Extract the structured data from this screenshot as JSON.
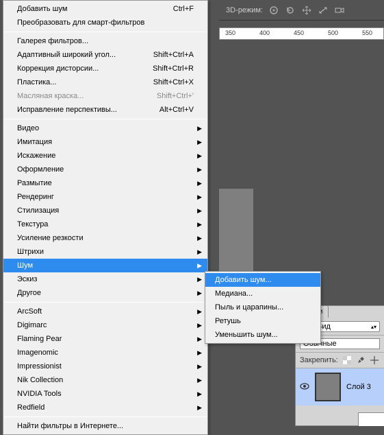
{
  "toolbar3d": {
    "label": "3D-режим:"
  },
  "ruler": {
    "ticks": [
      "350",
      "400",
      "450",
      "500",
      "550"
    ]
  },
  "panels": {
    "layersTab": "Слои",
    "viewLabel": "Вид",
    "blendMode": "Обычные",
    "lockLabel": "Закрепить:",
    "layerName": "Слой 3"
  },
  "menu": [
    {
      "type": "item",
      "label": "Добавить шум",
      "shortcut": "Ctrl+F"
    },
    {
      "type": "item",
      "label": "Преобразовать для смарт-фильтров"
    },
    {
      "type": "sep"
    },
    {
      "type": "item",
      "label": "Галерея фильтров..."
    },
    {
      "type": "item",
      "label": "Адаптивный широкий угол...",
      "shortcut": "Shift+Ctrl+A"
    },
    {
      "type": "item",
      "label": "Коррекция дисторсии...",
      "shortcut": "Shift+Ctrl+R"
    },
    {
      "type": "item",
      "label": "Пластика...",
      "shortcut": "Shift+Ctrl+X"
    },
    {
      "type": "item",
      "label": "Масляная краска...",
      "shortcut": "Shift+Ctrl+'",
      "disabled": true
    },
    {
      "type": "item",
      "label": "Исправление перспективы...",
      "shortcut": "Alt+Ctrl+V"
    },
    {
      "type": "sep"
    },
    {
      "type": "item",
      "label": "Видео",
      "submenu": true
    },
    {
      "type": "item",
      "label": "Имитация",
      "submenu": true
    },
    {
      "type": "item",
      "label": "Искажение",
      "submenu": true
    },
    {
      "type": "item",
      "label": "Оформление",
      "submenu": true
    },
    {
      "type": "item",
      "label": "Размытие",
      "submenu": true
    },
    {
      "type": "item",
      "label": "Рендеринг",
      "submenu": true
    },
    {
      "type": "item",
      "label": "Стилизация",
      "submenu": true
    },
    {
      "type": "item",
      "label": "Текстура",
      "submenu": true
    },
    {
      "type": "item",
      "label": "Усиление резкости",
      "submenu": true
    },
    {
      "type": "item",
      "label": "Штрихи",
      "submenu": true
    },
    {
      "type": "item",
      "label": "Шум",
      "submenu": true,
      "highlight": true
    },
    {
      "type": "item",
      "label": "Эскиз",
      "submenu": true
    },
    {
      "type": "item",
      "label": "Другое",
      "submenu": true
    },
    {
      "type": "sep"
    },
    {
      "type": "item",
      "label": "ArcSoft",
      "submenu": true
    },
    {
      "type": "item",
      "label": "Digimarc",
      "submenu": true
    },
    {
      "type": "item",
      "label": "Flaming Pear",
      "submenu": true
    },
    {
      "type": "item",
      "label": "Imagenomic",
      "submenu": true
    },
    {
      "type": "item",
      "label": "Impressionist",
      "submenu": true
    },
    {
      "type": "item",
      "label": "Nik Collection",
      "submenu": true
    },
    {
      "type": "item",
      "label": "NVIDIA Tools",
      "submenu": true
    },
    {
      "type": "item",
      "label": "Redfield",
      "submenu": true
    },
    {
      "type": "sep"
    },
    {
      "type": "item",
      "label": "Найти фильтры в Интернете..."
    }
  ],
  "submenu": [
    {
      "label": "Добавить шум...",
      "highlight": true
    },
    {
      "label": "Медиана..."
    },
    {
      "label": "Пыль и царапины..."
    },
    {
      "label": "Ретушь"
    },
    {
      "label": "Уменьшить шум..."
    }
  ]
}
